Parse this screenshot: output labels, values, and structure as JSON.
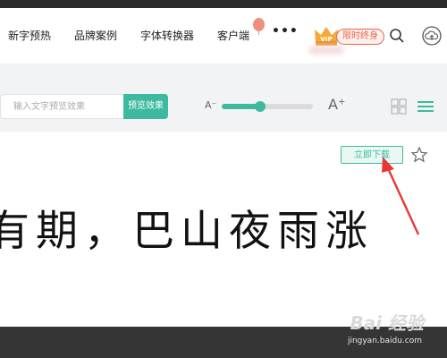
{
  "nav": {
    "items": [
      "新字预热",
      "品牌案例",
      "字体转换器",
      "客户端"
    ],
    "more": "•••",
    "vip_badge": "VIP",
    "vip_label": "限时终身",
    "icons": [
      "search-icon",
      "avatar-icon",
      "cloud-upload-icon"
    ]
  },
  "toolbar": {
    "search_placeholder": "输入文字预览效果",
    "preview_label": "预览效果",
    "font_size_decrease": "A⁻",
    "font_size_increase": "A⁺",
    "font_size_level": 0.42,
    "view_icons": [
      "grid-view-icon",
      "list-view-icon"
    ]
  },
  "content": {
    "download_label": "立即下载",
    "sample_text": "有期，巴山夜雨涨"
  },
  "watermark": {
    "brand": "Bai 经验",
    "url": "jingyan.baidu.com"
  },
  "colors": {
    "accent": "#3dba9d",
    "vip": "#e8624d",
    "arrow": "#e53935"
  }
}
